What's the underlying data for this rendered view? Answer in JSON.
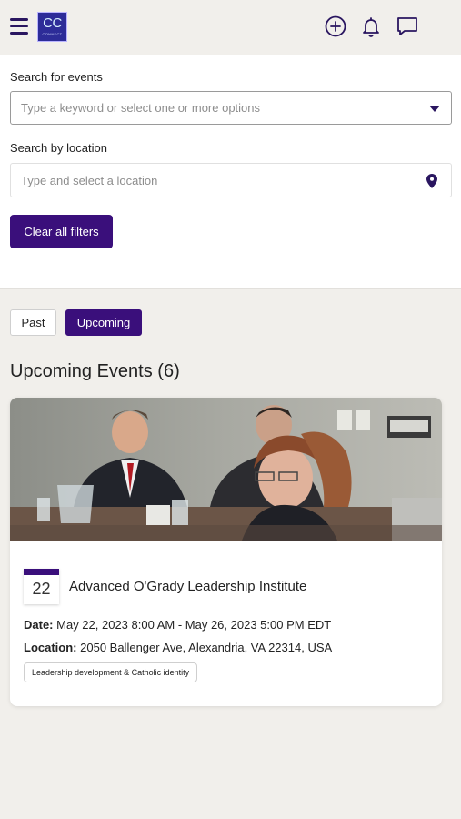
{
  "header": {
    "logo_text": "CC",
    "logo_subtext": "CONNECT",
    "icons": [
      "menu-icon",
      "add-circle-icon",
      "bell-icon",
      "chat-icon"
    ]
  },
  "filters": {
    "search_label": "Search for events",
    "search_placeholder": "Type a keyword or select one or more options",
    "location_label": "Search by location",
    "location_placeholder": "Type and select a location",
    "clear_label": "Clear all filters"
  },
  "tabs": [
    {
      "label": "Past",
      "active": false
    },
    {
      "label": "Upcoming",
      "active": true
    }
  ],
  "section_title": "Upcoming Events (6)",
  "events": [
    {
      "day": "22",
      "title": "Advanced O'Grady Leadership Institute",
      "date_label": "Date:",
      "date_value": "May 22, 2023 8:00 AM - May 26, 2023 5:00 PM EDT",
      "location_label": "Location:",
      "location_value": "2050 Ballenger Ave, Alexandria, VA 22314, USA",
      "tag": "Leadership development & Catholic identity"
    }
  ],
  "colors": {
    "accent": "#3a0f7b",
    "background": "#f1efeb",
    "logo_bg": "#2d2c98"
  }
}
